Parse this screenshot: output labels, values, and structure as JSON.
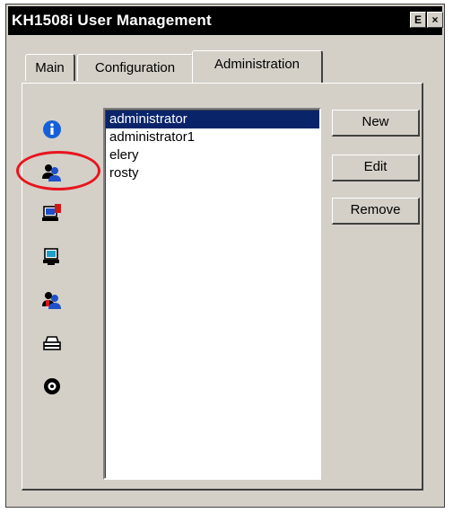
{
  "window": {
    "title": "KH1508i User Management",
    "help_button": "E",
    "close_button": "×"
  },
  "tabs": [
    {
      "label": "Main",
      "active": false
    },
    {
      "label": "Configuration",
      "active": false
    },
    {
      "label": "Administration",
      "active": true
    }
  ],
  "sidebar_icons": [
    {
      "name": "info-icon"
    },
    {
      "name": "user-management-icon",
      "highlighted": true
    },
    {
      "name": "computer-alert-icon"
    },
    {
      "name": "network-computer-icon"
    },
    {
      "name": "user-alert-icon"
    },
    {
      "name": "printer-icon"
    },
    {
      "name": "settings-gear-icon"
    }
  ],
  "users": [
    "administrator",
    "administrator1",
    "elery",
    "rosty"
  ],
  "selected_user": "administrator",
  "buttons": {
    "new": "New",
    "edit": "Edit",
    "remove": "Remove"
  },
  "colors": {
    "selection": "#0a246a",
    "highlight_ring": "#e8141e",
    "info_blue": "#1560d8",
    "user_blue": "#1f4fc9",
    "alert_red": "#d01818"
  }
}
